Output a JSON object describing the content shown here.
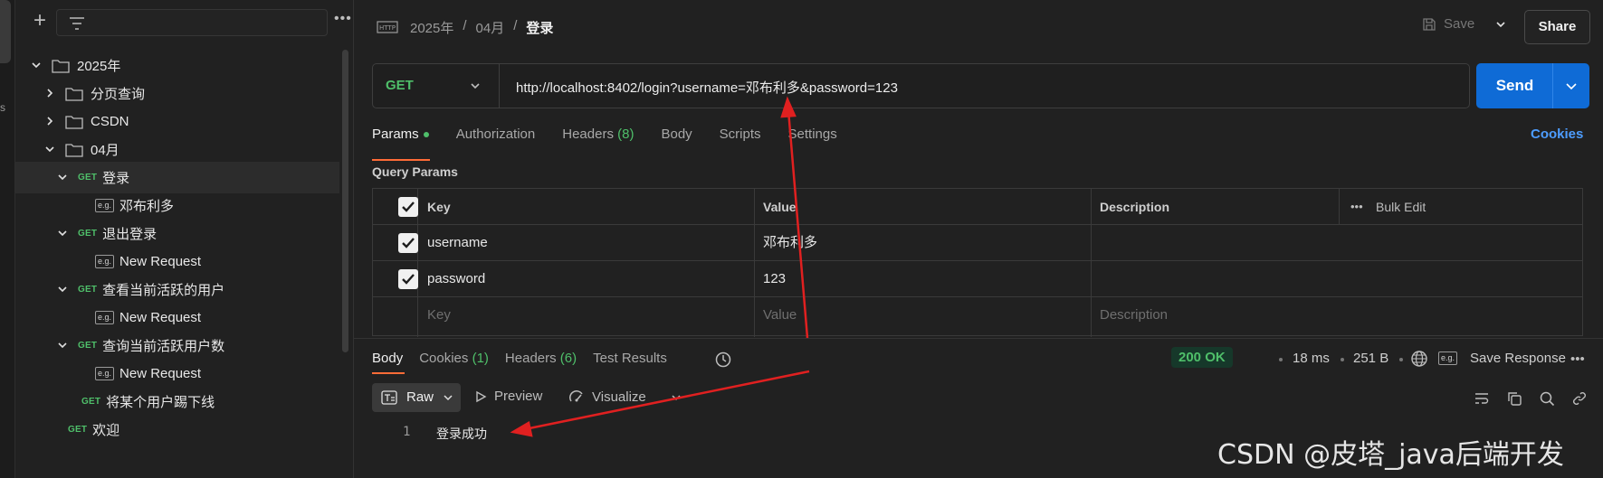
{
  "rail": {
    "partial_label": "s"
  },
  "sidebar": {
    "add_icon": "plus-icon",
    "filter_icon": "filter-icon",
    "more_label": "•••",
    "items": [
      {
        "type": "folder",
        "label": "2025年",
        "expanded": true
      },
      {
        "type": "folder",
        "label": "分页查询",
        "expanded": false
      },
      {
        "type": "folder",
        "label": "CSDN",
        "expanded": false
      },
      {
        "type": "folder",
        "label": "04月",
        "expanded": true
      },
      {
        "type": "request",
        "method": "GET",
        "label": "登录",
        "expanded": true,
        "selected": true
      },
      {
        "type": "example",
        "badge": "e.g.",
        "label": "邓布利多"
      },
      {
        "type": "request",
        "method": "GET",
        "label": "退出登录",
        "expanded": true
      },
      {
        "type": "example",
        "badge": "e.g.",
        "label": "New Request"
      },
      {
        "type": "request",
        "method": "GET",
        "label": "查看当前活跃的用户",
        "expanded": true
      },
      {
        "type": "example",
        "badge": "e.g.",
        "label": "New Request"
      },
      {
        "type": "request",
        "method": "GET",
        "label": "查询当前活跃用户数",
        "expanded": true
      },
      {
        "type": "example",
        "badge": "e.g.",
        "label": "New Request"
      },
      {
        "type": "request",
        "method": "GET",
        "label": "将某个用户踢下线"
      },
      {
        "type": "request",
        "method": "GET",
        "label": "欢迎"
      }
    ]
  },
  "header": {
    "breadcrumb": [
      "2025年",
      "/",
      "04月",
      "/",
      "登录"
    ],
    "save_label": "Save",
    "share_label": "Share"
  },
  "request": {
    "method": "GET",
    "url": "http://localhost:8402/login?username=邓布利多&password=123",
    "send_label": "Send",
    "tabs": [
      {
        "label": "Params",
        "active": true,
        "dot": true
      },
      {
        "label": "Authorization"
      },
      {
        "label": "Headers",
        "count": "(8)"
      },
      {
        "label": "Body"
      },
      {
        "label": "Scripts"
      },
      {
        "label": "Settings"
      }
    ],
    "cookies_label": "Cookies",
    "query_params_title": "Query Params",
    "table": {
      "headers": {
        "key": "Key",
        "value": "Value",
        "description": "Description",
        "bulk_edit": "Bulk Edit",
        "more": "•••"
      },
      "rows": [
        {
          "checked": true,
          "key": "username",
          "value": "邓布利多",
          "description": ""
        },
        {
          "checked": true,
          "key": "password",
          "value": "123",
          "description": ""
        }
      ],
      "placeholder": {
        "key": "Key",
        "value": "Value",
        "description": "Description"
      }
    }
  },
  "response": {
    "tabs": [
      {
        "label": "Body",
        "active": true
      },
      {
        "label": "Cookies",
        "count": "(1)"
      },
      {
        "label": "Headers",
        "count": "(6)"
      },
      {
        "label": "Test Results"
      }
    ],
    "status": "200 OK",
    "time": "18 ms",
    "size": "251 B",
    "save_label": "Save Response",
    "more_label": "•••",
    "view": {
      "raw_label": "Raw",
      "preview_label": "Preview",
      "visualize_label": "Visualize"
    },
    "body_lines": [
      {
        "number": "1",
        "text": "登录成功"
      }
    ]
  },
  "watermark": "CSDN @皮塔_java后端开发",
  "colors": {
    "get": "#4fbf6a",
    "accent": "#ff6c37",
    "send": "#0f6bd6",
    "annotation_arrow": "#e02020"
  }
}
